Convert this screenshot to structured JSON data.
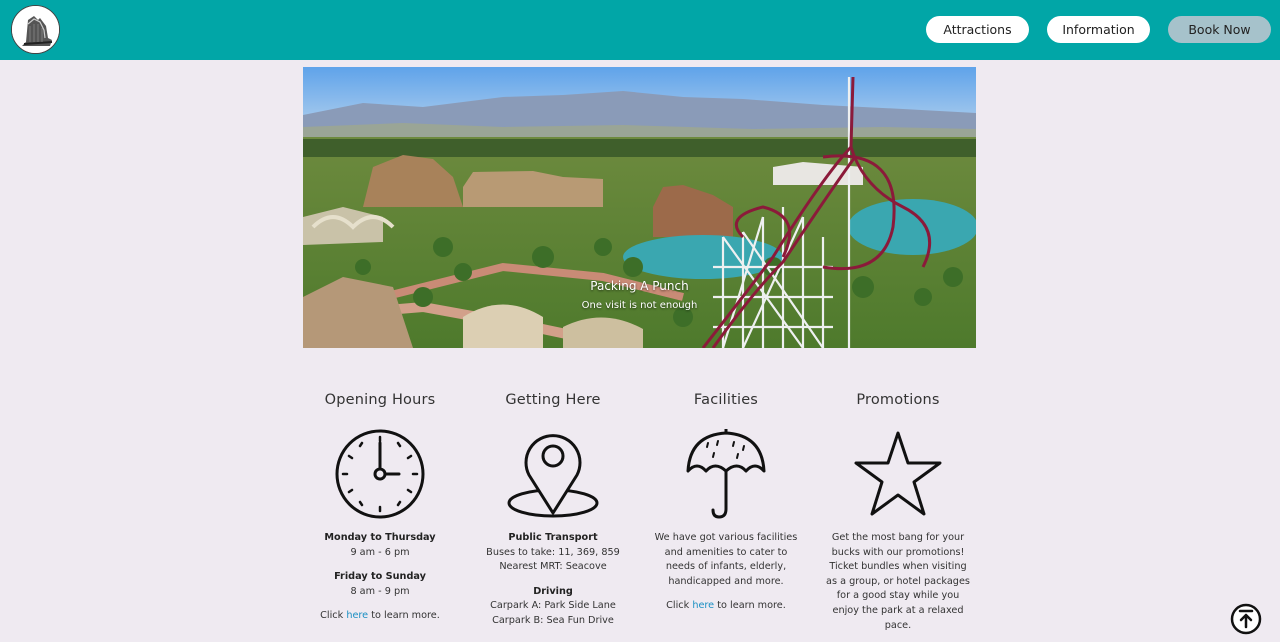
{
  "nav": {
    "attractions": "Attractions",
    "information": "Information",
    "book_now": "Book Now"
  },
  "hero": {
    "title": "Packing A Punch",
    "subtitle": "One visit is not enough"
  },
  "columns": [
    {
      "title": "Opening Hours",
      "icon": "clock-icon",
      "rows": [
        {
          "heading": "Monday to Thursday",
          "text": "9 am - 6 pm"
        },
        {
          "heading": "Friday to Sunday",
          "text": "8 am - 9 pm"
        }
      ],
      "cta_prefix": "Click ",
      "cta_link": "here",
      "cta_suffix": " to learn more."
    },
    {
      "title": "Getting Here",
      "icon": "location-pin-icon",
      "transport_heading": "Public Transport",
      "transport_lines": [
        "Buses to take: 11, 369, 859",
        "Nearest MRT: Seacove"
      ],
      "driving_heading": "Driving",
      "driving_lines": [
        "Carpark A: Park Side Lane",
        "Carpark B: Sea Fun Drive"
      ]
    },
    {
      "title": "Facilities",
      "icon": "umbrella-icon",
      "body": "We have got various facilities and amenities to cater to needs of infants, elderly, handicapped and more.",
      "cta_prefix": "Click ",
      "cta_link": "here",
      "cta_suffix": " to learn more."
    },
    {
      "title": "Promotions",
      "icon": "star-icon",
      "body": "Get the most bang for your bucks with our promotions! Ticket bundles when visiting as a group, or hotel packages for a good stay while you enjoy the park at a relaxed pace."
    }
  ],
  "colors": {
    "topbar": "#01a6a7",
    "page_bg": "#efeaf1",
    "book_button": "#a6c2cb",
    "link": "#1a8fc3"
  }
}
